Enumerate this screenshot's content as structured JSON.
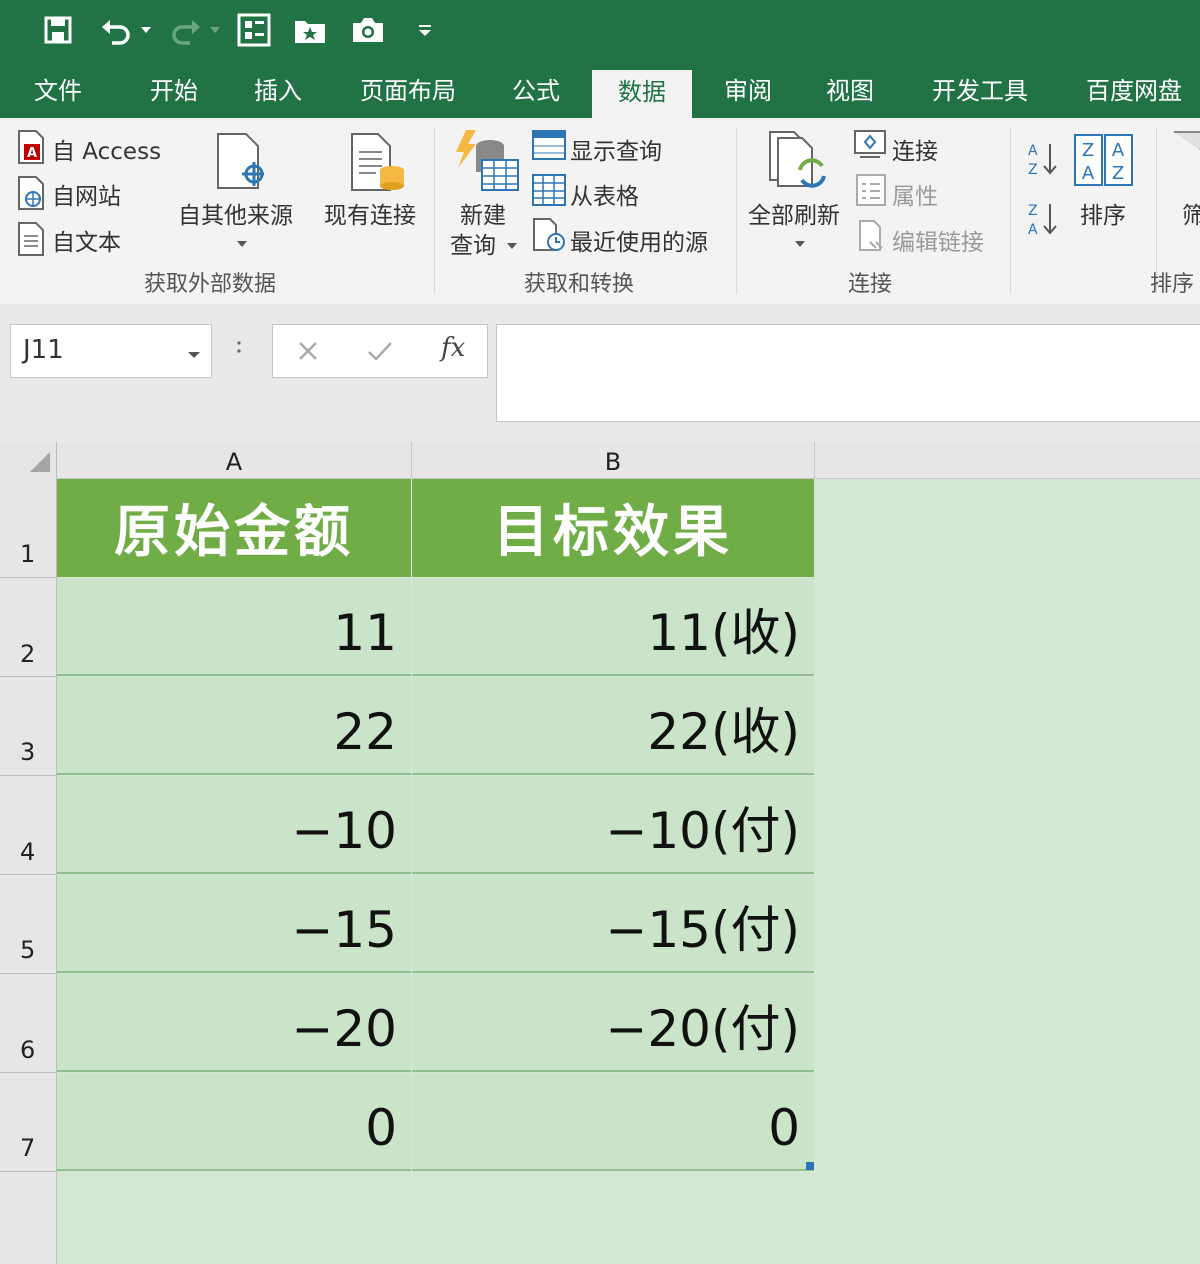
{
  "tabs": [
    "文件",
    "开始",
    "插入",
    "页面布局",
    "公式",
    "数据",
    "审阅",
    "视图",
    "开发工具",
    "百度网盘"
  ],
  "active_tab": "数据",
  "ribbon": {
    "get_external": {
      "from_access": "自 Access",
      "from_web": "自网站",
      "from_text": "自文本",
      "from_other": "自其他来源",
      "existing": "现有连接",
      "group_label": "获取外部数据"
    },
    "get_transform": {
      "new_query_1": "新建",
      "new_query_2": "查询",
      "show_queries": "显示查询",
      "from_table": "从表格",
      "recent_sources": "最近使用的源",
      "group_label": "获取和转换"
    },
    "connections": {
      "refresh_all": "全部刷新",
      "connections": "连接",
      "properties": "属性",
      "edit_links": "编辑链接",
      "group_label": "连接"
    },
    "sort_filter": {
      "sort": "排序",
      "filter_partial": "筛",
      "group_label": "排序"
    }
  },
  "formula_bar": {
    "name_box": "J11",
    "fx": "fx",
    "formula": ""
  },
  "columns": [
    "A",
    "B"
  ],
  "rows": [
    "1",
    "2",
    "3",
    "4",
    "5",
    "6",
    "7"
  ],
  "header_row": [
    "原始金额",
    "目标效果"
  ],
  "data_rows": [
    [
      "11",
      "11(收)"
    ],
    [
      "22",
      "22(收)"
    ],
    [
      "−10",
      "−10(付)"
    ],
    [
      "−15",
      "−15(付)"
    ],
    [
      "−20",
      "−20(付)"
    ],
    [
      "0",
      "0"
    ]
  ],
  "colors": {
    "title_green": "#217346",
    "header_fill": "#70ad47",
    "cell_fill": "#c9e4c9"
  }
}
